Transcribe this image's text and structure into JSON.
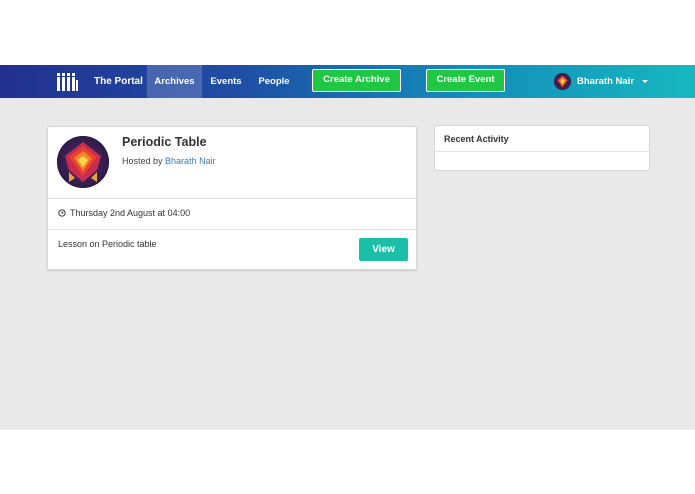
{
  "navbar": {
    "logo_icon": "portal-bars-logo-icon",
    "brand": "The Portal",
    "links": [
      {
        "label": "Archives",
        "active": true
      },
      {
        "label": "Events",
        "active": false
      },
      {
        "label": "People",
        "active": false
      }
    ],
    "create_archive_label": "Create Archive",
    "create_event_label": "Create Event",
    "user": {
      "name": "Bharath Nair",
      "avatar_icon": "user-avatar-icon",
      "dropdown_icon": "caret-down-icon"
    },
    "colors": {
      "gradient_start": "#22308f",
      "gradient_end": "#16b8c0",
      "button_green": "#1fc742"
    }
  },
  "event_card": {
    "title": "Periodic Table",
    "host_prefix": "Hosted by",
    "host_name": "Bharath Nair",
    "time_icon": "clock-icon",
    "time": "Thursday 2nd August at 04:00",
    "description": "Lesson on Periodic table",
    "view_label": "View",
    "colors": {
      "view_button": "#1bbfa7",
      "host_link": "#3a79c9"
    }
  },
  "recent_activity": {
    "title": "Recent Activity"
  }
}
